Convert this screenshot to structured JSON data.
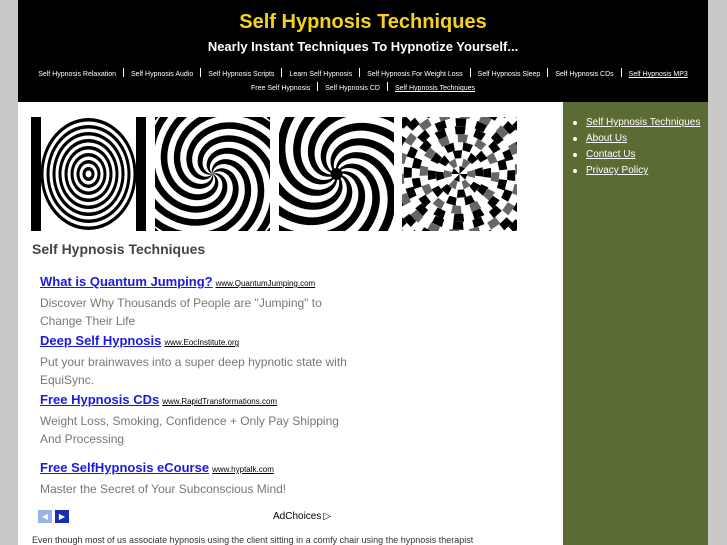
{
  "header": {
    "site_title": "Self Hypnosis Techniques",
    "tagline": "Nearly Instant Techniques To Hypnotize Yourself..."
  },
  "nav": {
    "row1": [
      "Self Hypnosis Relaxation",
      "Self Hypnosis Audio",
      "Self Hypnosis Scripts",
      "Learn Self Hypnosis",
      "Self Hypnosis For Weight Loss",
      "Self Hypnosis Sleep",
      "Self Hypnosis CDs",
      "Self Hypnosis MP3"
    ],
    "row2": [
      "Free Self Hypnosis",
      "Self Hypnosis CD",
      "Self Hypnosis Techniques"
    ]
  },
  "main": {
    "heading": "Self Hypnosis Techniques",
    "ads": [
      {
        "title": "What is Quantum Jumping?",
        "domain": "www.QuantumJumping.com",
        "desc": "Discover Why Thousands of People are \"Jumping\" to Change Their Life"
      },
      {
        "title": "Deep Self Hypnosis",
        "domain": "www.EocInstitute.org",
        "desc": "Put your brainwaves into a super deep hypnotic state with EquiSync."
      },
      {
        "title": "Free Hypnosis CDs",
        "domain": "www.RapidTransformations.com",
        "desc": "Weight Loss, Smoking, Confidence + Only Pay Shipping And Processing"
      },
      {
        "title": "Free SelfHypnosis eCourse",
        "domain": "www.hyptalk.com",
        "desc": "Master the Secret of Your Subconscious Mind!"
      }
    ],
    "ad_prev_glyph": "◀",
    "ad_next_glyph": "▶",
    "adchoices_label": "AdChoices",
    "adchoices_icon_glyph": "▷",
    "body_text": "Even though most of us associate hypnosis using the client sitting in a comfy chair using the hypnosis therapist"
  },
  "sidebar": {
    "links": [
      "Self Hypnosis Techniques",
      "About Us",
      "Contact Us",
      "Privacy Policy"
    ]
  },
  "colors": {
    "header_bg": "#000000",
    "title_yellow": "#f5d31b",
    "sidebar_green": "#5a6b34",
    "ad_title_blue": "#1a1ae6",
    "page_bg": "#c9c9c9"
  },
  "icons": {
    "ad_prev": "chevron-left-icon",
    "ad_next": "chevron-right-icon",
    "adchoices": "adchoices-icon"
  }
}
